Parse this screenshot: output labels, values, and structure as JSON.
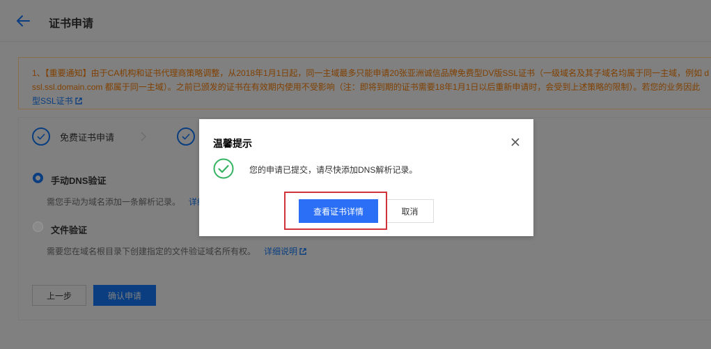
{
  "header": {
    "title": "证书申请"
  },
  "notice": {
    "line1": "1、【重要通知】由于CA机构和证书代理商策略调整，从2018年1月1日起，同一主域最多只能申请20张亚洲诚信品牌免费型DV版SSL证书（一级域名及其子域名均属于同一主域，例如 d",
    "line2": "ssl.ssl.domain.com 都属于同一主域）。之前已颁发的证书在有效期内使用不受影响（注：即将到期的证书需要18年1月1日以后重新申请时，会受到上述策略的限制）。若您的业务因此",
    "line3_link": "型SSL证书"
  },
  "steps": [
    {
      "label": "免费证书申请"
    }
  ],
  "options": [
    {
      "title": "手动DNS验证",
      "desc": "需您手动为域名添加一条解析记录。",
      "link": "详细"
    },
    {
      "title": "文件验证",
      "desc": "需要您在域名根目录下创建指定的文件验证域名所有权。",
      "link": "详细说明"
    }
  ],
  "buttons": {
    "prev": "上一步",
    "confirm": "确认申请"
  },
  "modal": {
    "title": "温馨提示",
    "message": "您的申请已提交，请尽快添加DNS解析记录。",
    "view_label": "查看证书详情",
    "cancel_label": "取消"
  },
  "colors": {
    "primary": "#2a6ff5",
    "success": "#34b361",
    "highlight": "#d0333a",
    "overlay": "#808080"
  }
}
